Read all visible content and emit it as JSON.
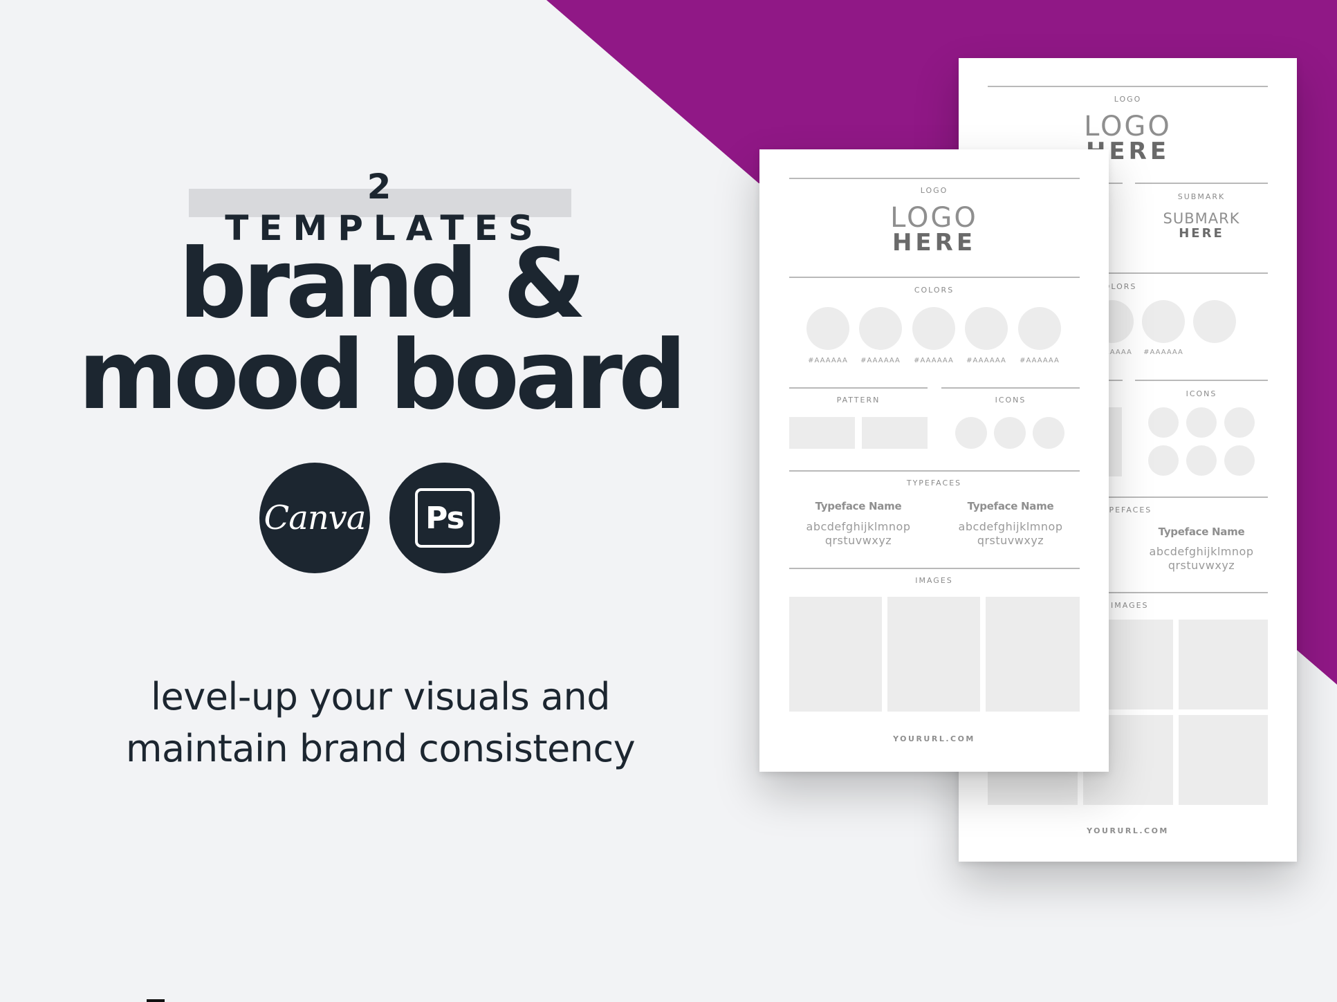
{
  "theme": {
    "background": "#f2f3f5",
    "accent_purple": "#901886",
    "text_dark": "#1c2630",
    "placeholder_gray": "#ececec"
  },
  "hero": {
    "kicker": "2 TEMPLATES",
    "headline_line1": "brand &",
    "headline_line2": "mood board",
    "tagline_line1": "level-up your visuals and",
    "tagline_line2": "maintain brand consistency"
  },
  "apps": [
    {
      "name": "Canva",
      "icon": "canva-logo",
      "label": "Canva"
    },
    {
      "name": "Photoshop",
      "icon": "photoshop-logo",
      "label": "Ps"
    }
  ],
  "template_front": {
    "logo_section": {
      "label": "LOGO",
      "placeholder_line1": "LOGO",
      "placeholder_line2": "HERE"
    },
    "colors_section": {
      "label": "COLORS",
      "swatches": [
        "#AAAAAA",
        "#AAAAAA",
        "#AAAAAA",
        "#AAAAAA",
        "#AAAAAA"
      ]
    },
    "pattern_section": {
      "label": "PATTERN"
    },
    "icons_section": {
      "label": "ICONS"
    },
    "typefaces_section": {
      "label": "TYPEFACES",
      "typefaces": [
        {
          "name": "Typeface Name",
          "sample_line1": "abcdefghijklmnop",
          "sample_line2": "qrstuvwxyz"
        },
        {
          "name": "Typeface Name",
          "sample_line1": "abcdefghijklmnop",
          "sample_line2": "qrstuvwxyz"
        }
      ]
    },
    "images_section": {
      "label": "IMAGES"
    },
    "footer_url": "YOURURL.COM"
  },
  "template_back": {
    "logo_section": {
      "label": "LOGO",
      "placeholder_line1": "LOGO",
      "placeholder_line2": "HERE"
    },
    "submark_section": {
      "label": "SUBMARK",
      "placeholder_line1": "SUBMARK",
      "placeholder_line2": "HERE"
    },
    "colors_section": {
      "label": "COLORS",
      "swatches": [
        "#AAAAAA",
        "#AAAAAA",
        "#AAAAAA"
      ]
    },
    "icons_section": {
      "label": "ICONS"
    },
    "typefaces_section": {
      "label": "TYPEFACES",
      "typefaces": [
        {
          "name": "Typeface Name",
          "sample_line1": "abcdefghijklmnop",
          "sample_line2": "qrstuvwxyz"
        }
      ]
    },
    "images_section": {
      "label": "IMAGES"
    },
    "footer_url": "YOURURL.COM"
  }
}
